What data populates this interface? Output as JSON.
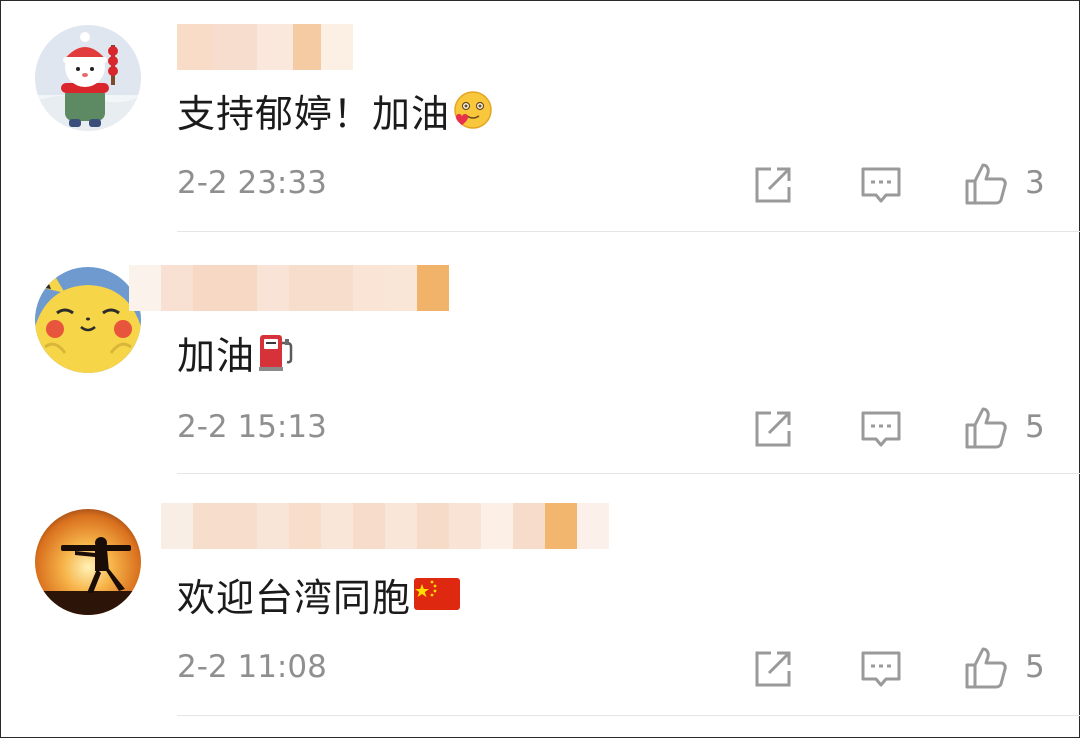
{
  "colors": {
    "text": "#1b1b1b",
    "meta": "#8f8f8f",
    "divider": "#e6e6e6",
    "icon": "#9a9a9a"
  },
  "comments": [
    {
      "avatar": "snowman-avatar",
      "username": "",
      "text": "支持郁婷！加油",
      "emoji": "smiling-face-with-heart-emoji",
      "time": "2-2 23:33",
      "likes": "3"
    },
    {
      "avatar": "pikachu-avatar",
      "username": "",
      "text": "加油",
      "emoji": "fuel-pump-emoji",
      "time": "2-2 15:13",
      "likes": "5"
    },
    {
      "avatar": "soldier-silhouette-avatar",
      "username": "",
      "text": "欢迎台湾同胞",
      "emoji": "china-flag-emoji",
      "time": "2-2 11:08",
      "likes": "5"
    }
  ],
  "actions": {
    "share_icon": "share-icon",
    "reply_icon": "comment-icon",
    "like_icon": "thumbs-up-icon"
  }
}
